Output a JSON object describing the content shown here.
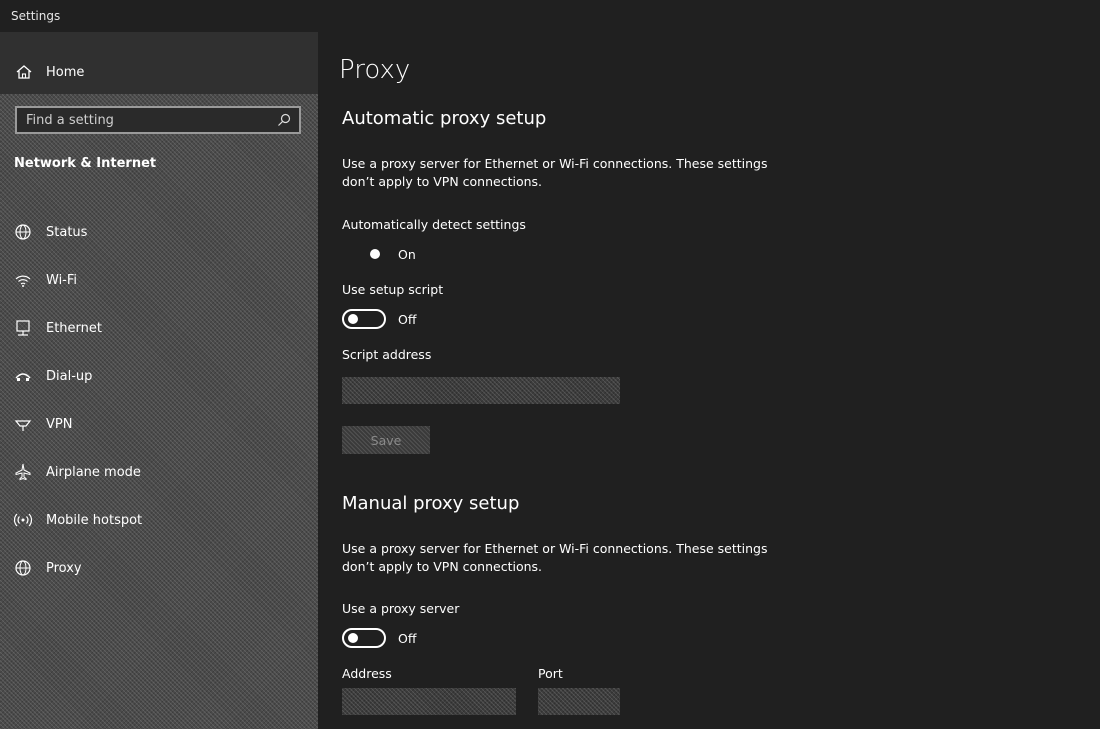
{
  "window": {
    "title": "Settings"
  },
  "sidebar": {
    "home_label": "Home",
    "search_placeholder": "Find a setting",
    "section_title": "Network & Internet",
    "items": [
      {
        "label": "Status",
        "icon": "globe-icon"
      },
      {
        "label": "Wi-Fi",
        "icon": "wifi-icon"
      },
      {
        "label": "Ethernet",
        "icon": "ethernet-icon"
      },
      {
        "label": "Dial-up",
        "icon": "dialup-icon"
      },
      {
        "label": "VPN",
        "icon": "vpn-icon"
      },
      {
        "label": "Airplane mode",
        "icon": "airplane-icon"
      },
      {
        "label": "Mobile hotspot",
        "icon": "hotspot-icon"
      },
      {
        "label": "Proxy",
        "icon": "proxy-icon"
      }
    ]
  },
  "main": {
    "page_title": "Proxy",
    "auto": {
      "heading": "Automatic proxy setup",
      "description": "Use a proxy server for Ethernet or Wi-Fi connections. These settings don’t apply to VPN connections.",
      "detect_label": "Automatically detect settings",
      "detect_state": "On",
      "script_label": "Use setup script",
      "script_state": "Off",
      "address_label": "Script address",
      "save_label": "Save"
    },
    "manual": {
      "heading": "Manual proxy setup",
      "description": "Use a proxy server for Ethernet or Wi-Fi connections. These settings don’t apply to VPN connections.",
      "use_label": "Use a proxy server",
      "use_state": "Off",
      "address_label": "Address",
      "port_label": "Port"
    }
  }
}
